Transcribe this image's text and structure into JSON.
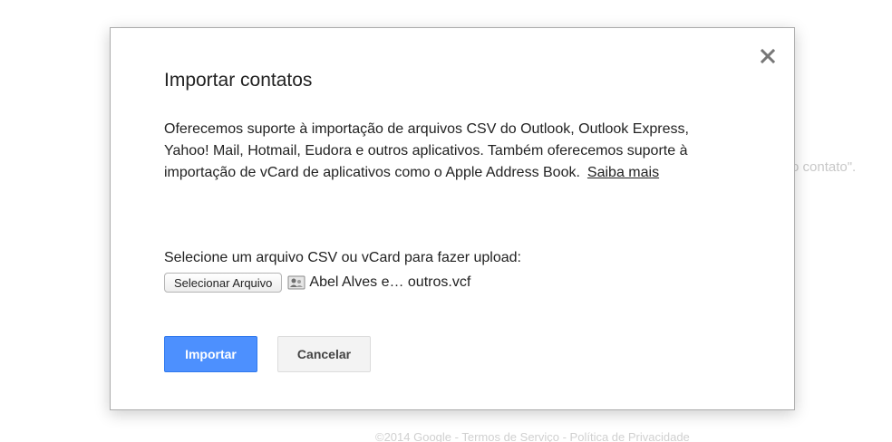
{
  "background": {
    "contato_fragment": "o contato\".",
    "footer": "©2014 Google - Termos de Serviço - Política de Privacidade"
  },
  "dialog": {
    "title": "Importar contatos",
    "description": "Oferecemos suporte à importação de arquivos CSV do Outlook, Outlook Express, Yahoo! Mail, Hotmail, Eudora e outros aplicativos. Também oferecemos suporte à importação de vCard de aplicativos como o Apple Address Book.",
    "learn_more_link": "Saiba mais",
    "upload_label": "Selecione um arquivo CSV ou vCard para fazer upload:",
    "choose_file_button": "Selecionar Arquivo",
    "selected_file_name": "Abel Alves e… outros.vcf",
    "import_button": "Importar",
    "cancel_button": "Cancelar",
    "close_icon": "close-icon",
    "file_icon": "vcard-file-icon"
  },
  "colors": {
    "primary_button": "#4d90fe",
    "primary_border": "#3079ed",
    "secondary_button": "#f3f3f3",
    "text": "#222222"
  }
}
